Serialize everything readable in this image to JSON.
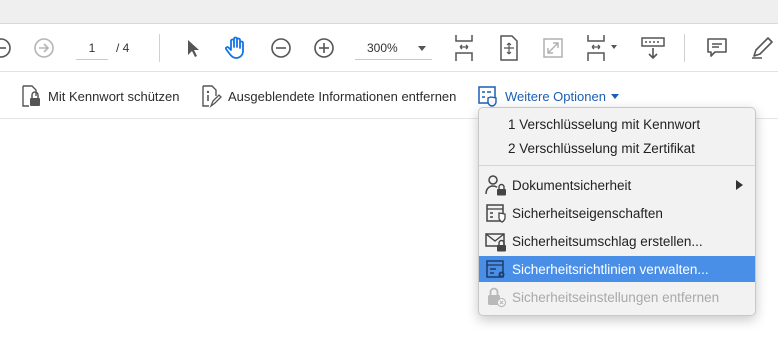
{
  "toolbar": {
    "page_current": "1",
    "page_total": "/ 4",
    "zoom_value": "300%",
    "icons": [
      "zoom-out-circle-icon",
      "next-page-icon",
      "select-arrow-icon",
      "hand-tool-icon",
      "zoom-out-icon",
      "zoom-in-icon",
      "fit-page-icon",
      "rotate-icon",
      "full-screen-icon",
      "fit-width-icon",
      "scroll-mode-icon",
      "comment-icon",
      "pen-icon"
    ]
  },
  "security_bar": {
    "password_label": "Mit Kennwort schützen",
    "hidden_info_label": "Ausgeblendete Informationen entfernen",
    "more_options_label": "Weitere Optionen"
  },
  "menu": {
    "items": [
      {
        "label": "1 Verschlüsselung mit Kennwort",
        "state": "normal"
      },
      {
        "label": "2 Verschlüsselung mit Zertifikat",
        "state": "normal"
      },
      {
        "label": "Dokumentsicherheit",
        "state": "normal",
        "icon": "user-lock-icon",
        "submenu": true
      },
      {
        "label": "Sicherheitseigenschaften",
        "state": "normal",
        "icon": "security-properties-icon"
      },
      {
        "label": "Sicherheitsumschlag erstellen...",
        "state": "normal",
        "icon": "envelope-lock-icon"
      },
      {
        "label": "Sicherheitsrichtlinien verwalten...",
        "state": "selected",
        "icon": "policy-gear-icon"
      },
      {
        "label": "Sicherheitseinstellungen entfernen",
        "state": "disabled",
        "icon": "lock-remove-icon"
      }
    ]
  },
  "colors": {
    "accent_blue": "#1a5fb4",
    "menu_highlight": "#4a8fe7",
    "menu_background": "#f2f2f2",
    "disabled_text": "#a9a9a9"
  }
}
